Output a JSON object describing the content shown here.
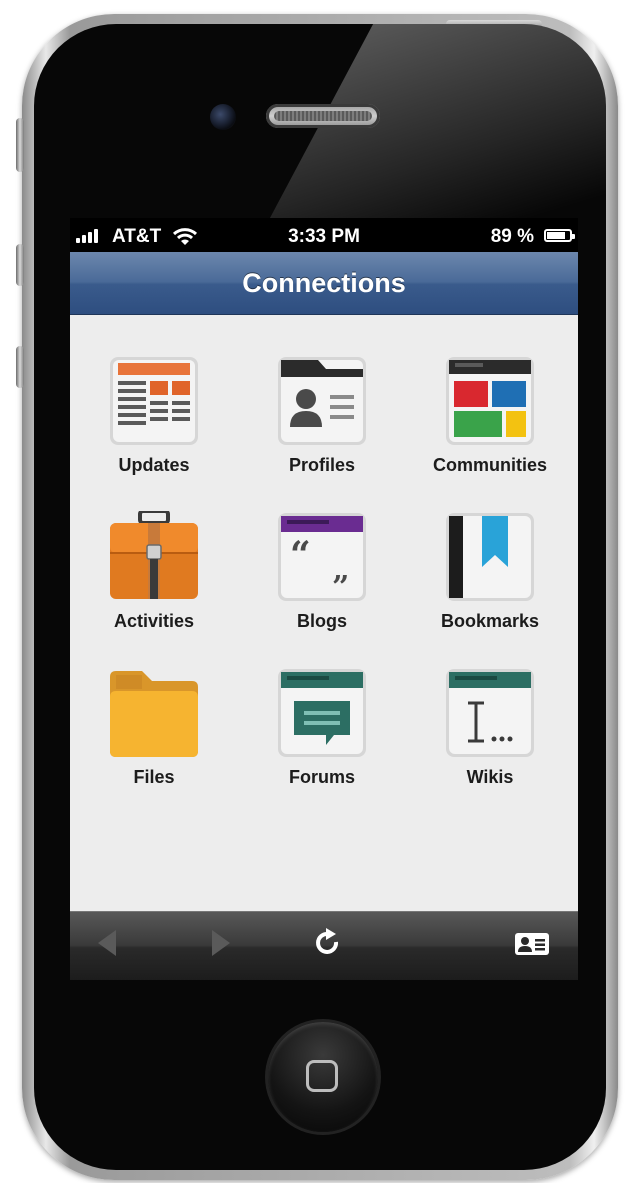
{
  "status_bar": {
    "carrier": "AT&T",
    "time": "3:33 PM",
    "battery": "89 %"
  },
  "navbar": {
    "title": "Connections"
  },
  "apps": [
    {
      "label": "Updates",
      "icon": "updates-icon"
    },
    {
      "label": "Profiles",
      "icon": "profiles-icon"
    },
    {
      "label": "Communities",
      "icon": "communities-icon"
    },
    {
      "label": "Activities",
      "icon": "activities-icon"
    },
    {
      "label": "Blogs",
      "icon": "blogs-icon"
    },
    {
      "label": "Bookmarks",
      "icon": "bookmarks-icon"
    },
    {
      "label": "Files",
      "icon": "files-icon"
    },
    {
      "label": "Forums",
      "icon": "forums-icon"
    },
    {
      "label": "Wikis",
      "icon": "wikis-icon"
    }
  ],
  "toolbar": {
    "items": [
      "back-arrow-icon",
      "forward-arrow-icon",
      "refresh-icon",
      "profile-card-icon"
    ]
  },
  "colors": {
    "navbar": "#3a5b8c",
    "content_bg": "#ededed",
    "toolbar": "#2a2a2a"
  }
}
